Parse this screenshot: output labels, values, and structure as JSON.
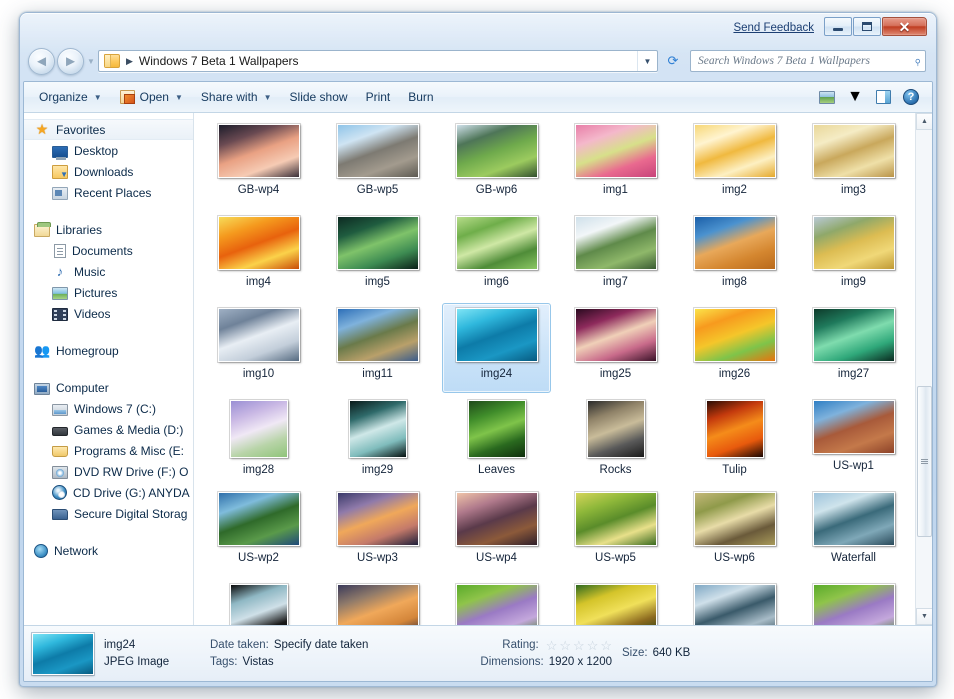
{
  "window": {
    "send_feedback": "Send Feedback",
    "minimize_label": "Minimize",
    "maximize_label": "Maximize",
    "close_label": "Close",
    "close_glyph": "✕"
  },
  "address": {
    "back_label": "Back",
    "forward_label": "Forward",
    "history_label": "Recent pages",
    "crumb_separator": "▶",
    "path": "Windows 7 Beta 1 Wallpapers",
    "dropdown_label": "Previous locations",
    "refresh_label": "Refresh"
  },
  "search": {
    "placeholder": "Search Windows 7 Beta 1 Wallpapers",
    "value": "",
    "icon": "search-icon"
  },
  "toolbar": {
    "items": [
      {
        "label": "Organize",
        "caret": true,
        "icon": null
      },
      {
        "label": "Open",
        "caret": true,
        "icon": "open-with-icon"
      },
      {
        "label": "Share with",
        "caret": true,
        "icon": null
      },
      {
        "label": "Slide show",
        "caret": false,
        "icon": null
      },
      {
        "label": "Print",
        "caret": false,
        "icon": null
      },
      {
        "label": "Burn",
        "caret": false,
        "icon": null
      }
    ],
    "views_label": "Change your view",
    "views_caret": "▼",
    "preview_pane_label": "Show the preview pane",
    "help_label": "Get help",
    "help_glyph": "?"
  },
  "navpane": {
    "groups": [
      {
        "header": {
          "label": "Favorites",
          "icon": "star-icon",
          "highlighted": true
        },
        "items": [
          {
            "label": "Desktop",
            "icon": "desktop-icon"
          },
          {
            "label": "Downloads",
            "icon": "downloads-icon"
          },
          {
            "label": "Recent Places",
            "icon": "recent-places-icon"
          }
        ]
      },
      {
        "header": {
          "label": "Libraries",
          "icon": "libraries-icon",
          "highlighted": false
        },
        "items": [
          {
            "label": "Documents",
            "icon": "documents-icon"
          },
          {
            "label": "Music",
            "icon": "music-icon"
          },
          {
            "label": "Pictures",
            "icon": "pictures-icon"
          },
          {
            "label": "Videos",
            "icon": "videos-icon"
          }
        ]
      },
      {
        "header": {
          "label": "Homegroup",
          "icon": "homegroup-icon",
          "highlighted": false
        },
        "items": []
      },
      {
        "header": {
          "label": "Computer",
          "icon": "computer-icon",
          "highlighted": false
        },
        "items": [
          {
            "label": "Windows 7 (C:)",
            "icon": "hard-drive-icon"
          },
          {
            "label": "Games & Media (D:)",
            "icon": "drive-icon"
          },
          {
            "label": "Programs & Misc (E:",
            "icon": "drive-icon"
          },
          {
            "label": "DVD RW Drive (F:) O",
            "icon": "dvd-drive-icon"
          },
          {
            "label": "CD Drive (G:) ANYDA",
            "icon": "cd-drive-icon"
          },
          {
            "label": "Secure Digital Storag",
            "icon": "sd-card-icon"
          }
        ]
      },
      {
        "header": {
          "label": "Network",
          "icon": "network-icon",
          "highlighted": false
        },
        "items": []
      }
    ]
  },
  "files": [
    {
      "name": "GB-wp4",
      "selected": false,
      "shape": "wide",
      "colors": [
        "#1b1c2a",
        "#6a4a52",
        "#e9a183",
        "#f6cbb4",
        "#3a2f38"
      ]
    },
    {
      "name": "GB-wp5",
      "selected": false,
      "shape": "wide",
      "colors": [
        "#8fc4e8",
        "#cfe4f3",
        "#7d7a72",
        "#a39b8e",
        "#5d5a52"
      ]
    },
    {
      "name": "GB-wp6",
      "selected": false,
      "shape": "wide",
      "colors": [
        "#cfe0ea",
        "#4e7558",
        "#6faa4c",
        "#9ccb5f",
        "#33502f"
      ]
    },
    {
      "name": "img1",
      "selected": false,
      "shape": "wide",
      "colors": [
        "#e87fa8",
        "#f4b8cb",
        "#d7e08a",
        "#e9698f",
        "#c7447a"
      ]
    },
    {
      "name": "img2",
      "selected": false,
      "shape": "wide",
      "colors": [
        "#f7d777",
        "#fff4d0",
        "#f0b93f",
        "#fdf0c2",
        "#e5a92c"
      ]
    },
    {
      "name": "img3",
      "selected": false,
      "shape": "wide",
      "colors": [
        "#e9d79a",
        "#f5ecc5",
        "#c9a85c",
        "#efe0a8",
        "#b99347"
      ]
    },
    {
      "name": "img4",
      "selected": false,
      "shape": "wide",
      "colors": [
        "#f7dc5a",
        "#f59a1e",
        "#e8620d",
        "#fbd24a",
        "#c94c08"
      ]
    },
    {
      "name": "img5",
      "selected": false,
      "shape": "wide",
      "colors": [
        "#0d2a22",
        "#1f5c3f",
        "#7fc36a",
        "#3d8b52",
        "#0a1f18"
      ]
    },
    {
      "name": "img6",
      "selected": false,
      "shape": "wide",
      "colors": [
        "#b7dc8a",
        "#6fae4a",
        "#cfe8a5",
        "#4f8c38",
        "#8cc764"
      ]
    },
    {
      "name": "img7",
      "selected": false,
      "shape": "wide",
      "colors": [
        "#cfe0ea",
        "#f2f6f8",
        "#5f8a4a",
        "#8fb86a",
        "#3a5c33"
      ]
    },
    {
      "name": "img8",
      "selected": false,
      "shape": "wide",
      "colors": [
        "#1b5fa8",
        "#4b92cf",
        "#e8a85a",
        "#d4862f",
        "#b96a1c"
      ]
    },
    {
      "name": "img9",
      "selected": false,
      "shape": "wide",
      "colors": [
        "#b9c9d6",
        "#8fa86a",
        "#dcbc52",
        "#f0d878",
        "#c09a35"
      ]
    },
    {
      "name": "img10",
      "selected": false,
      "shape": "wide",
      "colors": [
        "#9fb0c4",
        "#6f8299",
        "#e8eef4",
        "#c3ceda",
        "#556a80"
      ]
    },
    {
      "name": "img11",
      "selected": false,
      "shape": "wide",
      "colors": [
        "#2d6fb8",
        "#7fb2dc",
        "#6a7a4a",
        "#b9a06a",
        "#3a5c8c"
      ]
    },
    {
      "name": "img24",
      "selected": true,
      "shape": "wide",
      "colors": [
        "#7fe4f5",
        "#2fb8dd",
        "#0d7ba8",
        "#1a97c4",
        "#075a80"
      ]
    },
    {
      "name": "img25",
      "selected": false,
      "shape": "wide",
      "colors": [
        "#2a0a20",
        "#8e2a5c",
        "#f0d0b8",
        "#c86a8a",
        "#3a1228"
      ]
    },
    {
      "name": "img26",
      "selected": false,
      "shape": "wide",
      "colors": [
        "#fbe44a",
        "#f79a1e",
        "#f5c62a",
        "#7ec44a",
        "#e8730d"
      ]
    },
    {
      "name": "img27",
      "selected": false,
      "shape": "wide",
      "colors": [
        "#0d3a2a",
        "#1f7a5c",
        "#7fdcae",
        "#2fa87a",
        "#0a2a1f"
      ]
    },
    {
      "name": "img28",
      "selected": false,
      "shape": "sq",
      "colors": [
        "#9a8fd4",
        "#c9b8e4",
        "#f0e8f5",
        "#b8d4a8",
        "#8fc47a"
      ]
    },
    {
      "name": "img29",
      "selected": false,
      "shape": "sq",
      "colors": [
        "#0a1a1a",
        "#2f6a6a",
        "#cfe8e8",
        "#7fbcbc",
        "#05100f"
      ]
    },
    {
      "name": "Leaves",
      "selected": false,
      "shape": "sq",
      "colors": [
        "#1f4a1a",
        "#3f8c2a",
        "#7fc44a",
        "#2a6a1f",
        "#0f2f0d"
      ]
    },
    {
      "name": "Rocks",
      "selected": false,
      "shape": "sq",
      "colors": [
        "#2a2a2a",
        "#8f8268",
        "#c9bc9a",
        "#5a5a5a",
        "#1a1a1a"
      ]
    },
    {
      "name": "Tulip",
      "selected": false,
      "shape": "sq",
      "colors": [
        "#2a0d05",
        "#c43a0d",
        "#f58c1a",
        "#e85a0d",
        "#1a0703"
      ]
    },
    {
      "name": "US-wp1",
      "selected": false,
      "shape": "wide",
      "colors": [
        "#2f7fc4",
        "#7fb2dc",
        "#a85a3a",
        "#c4794a",
        "#8c4228"
      ]
    },
    {
      "name": "US-wp2",
      "selected": false,
      "shape": "wide",
      "colors": [
        "#2f6faa",
        "#7fbcdc",
        "#2f6a2a",
        "#5a9a4a",
        "#1f4a7a"
      ]
    },
    {
      "name": "US-wp3",
      "selected": false,
      "shape": "wide",
      "colors": [
        "#3a3a6a",
        "#8f7aaa",
        "#f0a85a",
        "#c47a6a",
        "#1f1f3a"
      ]
    },
    {
      "name": "US-wp4",
      "selected": false,
      "shape": "wide",
      "colors": [
        "#f0c4a8",
        "#b07a8c",
        "#5a3a4a",
        "#8c5a3a",
        "#2f1f2a"
      ]
    },
    {
      "name": "US-wp5",
      "selected": false,
      "shape": "wide",
      "colors": [
        "#d4d45a",
        "#8fb83a",
        "#5a8c2a",
        "#e8e08a",
        "#3a6a1f"
      ]
    },
    {
      "name": "US-wp6",
      "selected": false,
      "shape": "wide",
      "colors": [
        "#c4b87a",
        "#8f9a4a",
        "#e8dca8",
        "#6a5a3a",
        "#a89a5a"
      ]
    },
    {
      "name": "Waterfall",
      "selected": false,
      "shape": "wide",
      "colors": [
        "#9fc4dc",
        "#cfe4ec",
        "#3a6a7a",
        "#7fa8b8",
        "#2a4a5a"
      ]
    },
    {
      "name": "",
      "selected": false,
      "shape": "sq",
      "colors": [
        "#0a0a0a",
        "#8fb8c4",
        "#cfe0e8",
        "#1a1a1a",
        "#050505"
      ]
    },
    {
      "name": "",
      "selected": false,
      "shape": "wide",
      "colors": [
        "#3a3a5a",
        "#8f7a6a",
        "#f0a85a",
        "#d4863a",
        "#1f1f3a"
      ]
    },
    {
      "name": "",
      "selected": false,
      "shape": "wide",
      "colors": [
        "#5aaa2a",
        "#8fc44a",
        "#9a7ac4",
        "#c4a8dc",
        "#3a7a1f"
      ]
    },
    {
      "name": "",
      "selected": false,
      "shape": "wide",
      "colors": [
        "#2f6a1f",
        "#d4c42a",
        "#f0e05a",
        "#8c6a1f",
        "#1a3a0f"
      ]
    },
    {
      "name": "",
      "selected": false,
      "shape": "wide",
      "colors": [
        "#7fa8c4",
        "#cfe0ea",
        "#3a5a6a",
        "#a8bcc8",
        "#2a4450"
      ]
    },
    {
      "name": "",
      "selected": false,
      "shape": "wide",
      "colors": [
        "#5aaa2a",
        "#8fc44a",
        "#9a7ac4",
        "#c4a8dc",
        "#3a7a1f"
      ]
    }
  ],
  "scrollbar": {
    "up_label": "Scroll up",
    "down_label": "Scroll down",
    "up_glyph": "▲",
    "down_glyph": "▼"
  },
  "details": {
    "title": "img24",
    "filetype": "JPEG Image",
    "date_taken_label": "Date taken:",
    "date_taken_value": "Specify date taken",
    "tags_label": "Tags:",
    "tags_value": "Vistas",
    "rating_label": "Rating:",
    "rating_stars": 0,
    "rating_max": 5,
    "star_glyph": "☆",
    "dimensions_label": "Dimensions:",
    "dimensions_value": "1920 x 1200",
    "size_label": "Size:",
    "size_value": "640 KB"
  },
  "colors": {
    "accent": "#2f7fd4",
    "frame": "#c6daf0",
    "selection": "#bedcf6",
    "text": "#14243a",
    "close_button": "#bf3d21"
  }
}
